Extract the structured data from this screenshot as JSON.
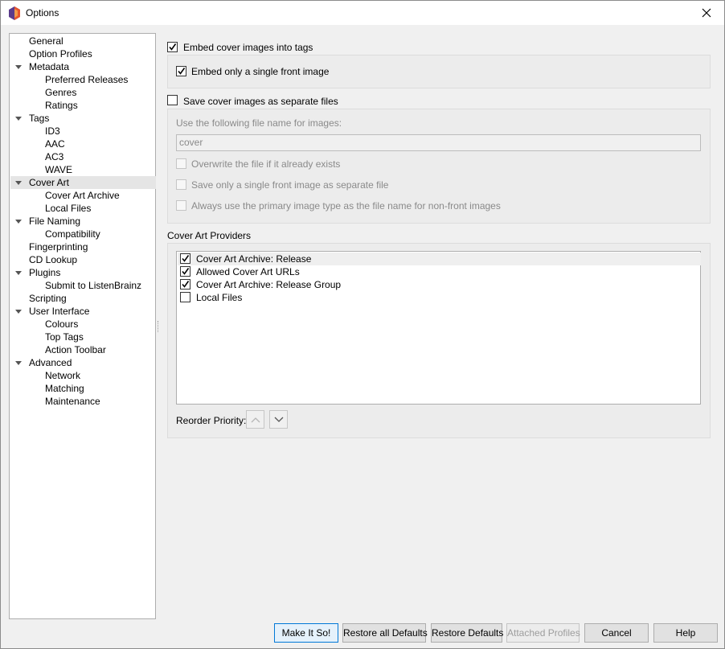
{
  "window": {
    "title": "Options"
  },
  "tree": [
    {
      "label": "General",
      "level": 0,
      "expandable": false
    },
    {
      "label": "Option Profiles",
      "level": 0,
      "expandable": false
    },
    {
      "label": "Metadata",
      "level": 0,
      "expandable": true
    },
    {
      "label": "Preferred Releases",
      "level": 1,
      "expandable": false
    },
    {
      "label": "Genres",
      "level": 1,
      "expandable": false
    },
    {
      "label": "Ratings",
      "level": 1,
      "expandable": false
    },
    {
      "label": "Tags",
      "level": 0,
      "expandable": true
    },
    {
      "label": "ID3",
      "level": 1,
      "expandable": false
    },
    {
      "label": "AAC",
      "level": 1,
      "expandable": false
    },
    {
      "label": "AC3",
      "level": 1,
      "expandable": false
    },
    {
      "label": "WAVE",
      "level": 1,
      "expandable": false
    },
    {
      "label": "Cover Art",
      "level": 0,
      "expandable": true,
      "selected": true
    },
    {
      "label": "Cover Art Archive",
      "level": 1,
      "expandable": false
    },
    {
      "label": "Local Files",
      "level": 1,
      "expandable": false
    },
    {
      "label": "File Naming",
      "level": 0,
      "expandable": true
    },
    {
      "label": "Compatibility",
      "level": 1,
      "expandable": false
    },
    {
      "label": "Fingerprinting",
      "level": 0,
      "expandable": false
    },
    {
      "label": "CD Lookup",
      "level": 0,
      "expandable": false
    },
    {
      "label": "Plugins",
      "level": 0,
      "expandable": true
    },
    {
      "label": "Submit to ListenBrainz",
      "level": 1,
      "expandable": false
    },
    {
      "label": "Scripting",
      "level": 0,
      "expandable": false
    },
    {
      "label": "User Interface",
      "level": 0,
      "expandable": true
    },
    {
      "label": "Colours",
      "level": 1,
      "expandable": false
    },
    {
      "label": "Top Tags",
      "level": 1,
      "expandable": false
    },
    {
      "label": "Action Toolbar",
      "level": 1,
      "expandable": false
    },
    {
      "label": "Advanced",
      "level": 0,
      "expandable": true
    },
    {
      "label": "Network",
      "level": 1,
      "expandable": false
    },
    {
      "label": "Matching",
      "level": 1,
      "expandable": false
    },
    {
      "label": "Maintenance",
      "level": 1,
      "expandable": false
    }
  ],
  "cover_art": {
    "embed_cover": {
      "label": "Embed cover images into tags",
      "checked": true
    },
    "embed_single": {
      "label": "Embed only a single front image",
      "checked": true
    },
    "save_separate": {
      "label": "Save cover images as separate files",
      "checked": false
    },
    "filename_label": "Use the following file name for images:",
    "filename_value": "cover",
    "overwrite": {
      "label": "Overwrite the file if it already exists",
      "checked": false
    },
    "save_single": {
      "label": "Save only a single front image as separate file",
      "checked": false
    },
    "primary_type": {
      "label": "Always use the primary image type as the file name for non-front images",
      "checked": false
    },
    "providers_title": "Cover Art Providers",
    "providers": [
      {
        "label": "Cover Art Archive: Release",
        "checked": true
      },
      {
        "label": "Allowed Cover Art URLs",
        "checked": true
      },
      {
        "label": "Cover Art Archive: Release Group",
        "checked": true
      },
      {
        "label": "Local Files",
        "checked": false
      }
    ],
    "reorder_label": "Reorder Priority:"
  },
  "buttons": {
    "make_it_so": "Make It So!",
    "restore_all": "Restore all Defaults",
    "restore": "Restore Defaults",
    "attached_profiles": "Attached Profiles",
    "cancel": "Cancel",
    "help": "Help"
  },
  "icons": {
    "app": "picard-hexagon-icon",
    "close": "close-icon",
    "up": "chevron-up-icon",
    "down": "chevron-down-icon"
  },
  "colors": {
    "selection": "#e5e5e5",
    "accent": "#0078d7",
    "logo_purple": "#5b3b8c",
    "logo_orange": "#e8552d"
  }
}
